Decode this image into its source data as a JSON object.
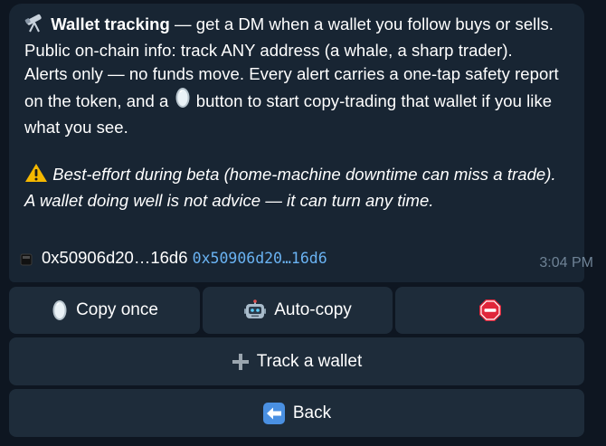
{
  "message": {
    "title": "Wallet tracking",
    "intro": " — get a DM when a wallet you follow buys or sells.",
    "line2": "Public on-chain info: track ANY address (a whale, a sharp trader).",
    "line3a": "Alerts only — no funds move. Every alert carries a one-tap safety report on the token, and a ",
    "line3b": " button to start copy-trading that wallet if you like what you see.",
    "warning": "Best-effort during beta (home-machine downtime can miss a trade). A wallet doing well is not advice — it can turn any time.",
    "wallet_label": "0x50906d20…16d6",
    "wallet_code": "0x50906d20…16d6",
    "time": "3:04 PM"
  },
  "buttons": {
    "copy_once": "Copy once",
    "auto_copy": "Auto-copy",
    "stop": "",
    "track_wallet": "Track a wallet",
    "back": "Back"
  },
  "icons": {
    "title": "telescope-icon",
    "mirror": "mirror-icon",
    "warning": "warning-icon",
    "wallet": "wallet-square-icon",
    "robot": "robot-icon",
    "stop": "stop-sign-icon",
    "plus": "plus-icon",
    "back": "back-arrow-icon"
  },
  "colors": {
    "background": "#0e1621",
    "bubble": "#182533",
    "button": "#1e2c3a",
    "link": "#6ab3f3",
    "time": "#6f8396"
  }
}
